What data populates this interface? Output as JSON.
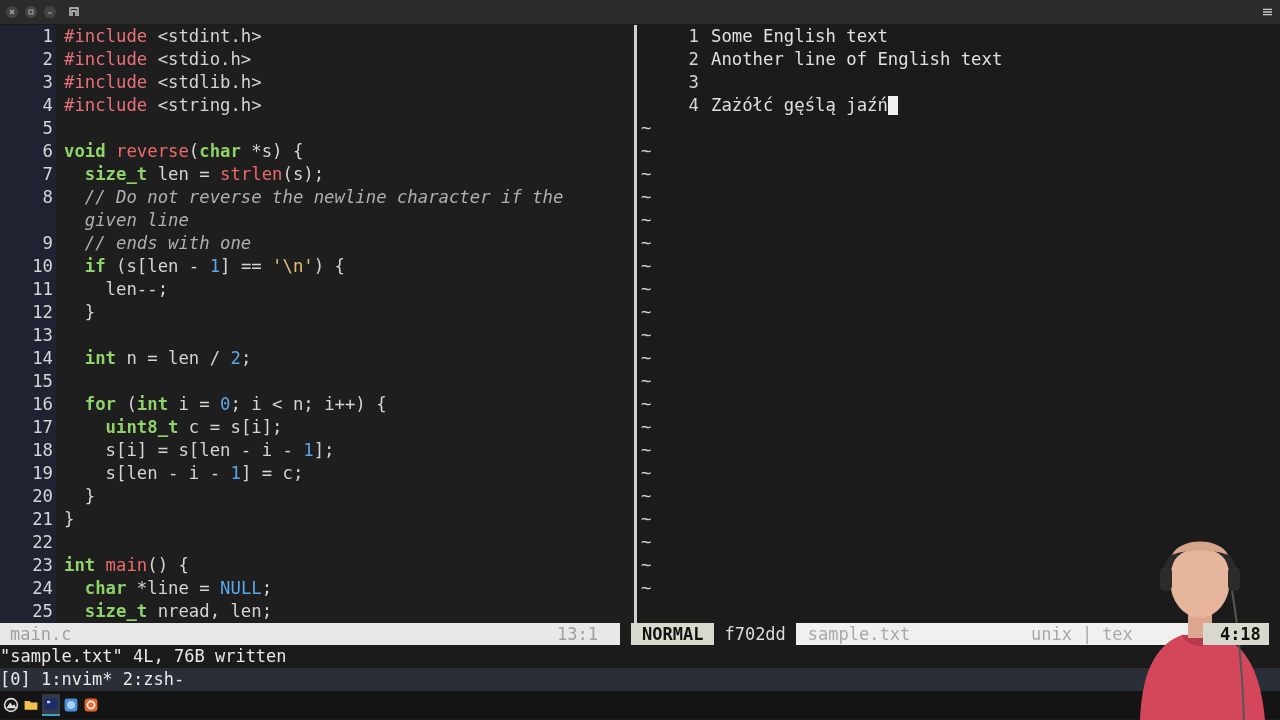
{
  "left_pane": {
    "lines": [
      {
        "num": "1",
        "tokens": [
          {
            "t": "#include",
            "kind": "pre"
          },
          {
            "t": " <stdint.h>",
            "kind": "plain"
          }
        ]
      },
      {
        "num": "2",
        "tokens": [
          {
            "t": "#include",
            "kind": "pre"
          },
          {
            "t": " <stdio.h>",
            "kind": "plain"
          }
        ]
      },
      {
        "num": "3",
        "tokens": [
          {
            "t": "#include",
            "kind": "pre"
          },
          {
            "t": " <stdlib.h>",
            "kind": "plain"
          }
        ]
      },
      {
        "num": "4",
        "tokens": [
          {
            "t": "#include",
            "kind": "pre"
          },
          {
            "t": " <string.h>",
            "kind": "plain"
          }
        ]
      },
      {
        "num": "5"
      },
      {
        "num": "6",
        "tokens": [
          {
            "t": "void",
            "kind": "type"
          },
          {
            "t": " reverse",
            "kind": "fn"
          },
          {
            "t": "(",
            "kind": "plain"
          },
          {
            "t": "char",
            "kind": "type"
          },
          {
            "t": " *s) {",
            "kind": "plain"
          }
        ]
      },
      {
        "num": "7",
        "tokens": [
          {
            "t": "  size_t",
            "kind": "type"
          },
          {
            "t": " len = ",
            "kind": "plain"
          },
          {
            "t": "strlen",
            "kind": "fn"
          },
          {
            "t": "(s);",
            "kind": "plain"
          }
        ]
      },
      {
        "num": "8",
        "tokens": [
          {
            "t": "  // Do not reverse the newline character if the",
            "kind": "com"
          }
        ]
      },
      {
        "tokens": [
          {
            "t": "  given line",
            "kind": "com"
          }
        ]
      },
      {
        "num": "9",
        "tokens": [
          {
            "t": "  // ends with one",
            "kind": "com"
          }
        ]
      },
      {
        "num": "10",
        "tokens": [
          {
            "t": "  if",
            "kind": "kw"
          },
          {
            "t": " (s[len - ",
            "kind": "plain"
          },
          {
            "t": "1",
            "kind": "num"
          },
          {
            "t": "] == ",
            "kind": "plain"
          },
          {
            "t": "'\\n'",
            "kind": "str"
          },
          {
            "t": ") {",
            "kind": "plain"
          }
        ]
      },
      {
        "num": "11",
        "tokens": [
          {
            "t": "    len--;",
            "kind": "plain"
          }
        ]
      },
      {
        "num": "12",
        "tokens": [
          {
            "t": "  }",
            "kind": "plain"
          }
        ]
      },
      {
        "num": "13"
      },
      {
        "num": "14",
        "tokens": [
          {
            "t": "  int",
            "kind": "type"
          },
          {
            "t": " n = len / ",
            "kind": "plain"
          },
          {
            "t": "2",
            "kind": "num"
          },
          {
            "t": ";",
            "kind": "plain"
          }
        ]
      },
      {
        "num": "15"
      },
      {
        "num": "16",
        "tokens": [
          {
            "t": "  for",
            "kind": "kw"
          },
          {
            "t": " (",
            "kind": "plain"
          },
          {
            "t": "int",
            "kind": "type"
          },
          {
            "t": " i = ",
            "kind": "plain"
          },
          {
            "t": "0",
            "kind": "num"
          },
          {
            "t": "; i < n; i++) {",
            "kind": "plain"
          }
        ]
      },
      {
        "num": "17",
        "tokens": [
          {
            "t": "    uint8_t",
            "kind": "type"
          },
          {
            "t": " c = s[i];",
            "kind": "plain"
          }
        ]
      },
      {
        "num": "18",
        "tokens": [
          {
            "t": "    s[i] = s[len - i - ",
            "kind": "plain"
          },
          {
            "t": "1",
            "kind": "num"
          },
          {
            "t": "];",
            "kind": "plain"
          }
        ]
      },
      {
        "num": "19",
        "tokens": [
          {
            "t": "    s[len - i - ",
            "kind": "plain"
          },
          {
            "t": "1",
            "kind": "num"
          },
          {
            "t": "] = c;",
            "kind": "plain"
          }
        ]
      },
      {
        "num": "20",
        "tokens": [
          {
            "t": "  }",
            "kind": "plain"
          }
        ]
      },
      {
        "num": "21",
        "tokens": [
          {
            "t": "}",
            "kind": "plain"
          }
        ]
      },
      {
        "num": "22"
      },
      {
        "num": "23",
        "tokens": [
          {
            "t": "int",
            "kind": "type"
          },
          {
            "t": " main",
            "kind": "fn"
          },
          {
            "t": "() {",
            "kind": "plain"
          }
        ]
      },
      {
        "num": "24",
        "tokens": [
          {
            "t": "  char",
            "kind": "type"
          },
          {
            "t": " *line = ",
            "kind": "plain"
          },
          {
            "t": "NULL",
            "kind": "const"
          },
          {
            "t": ";",
            "kind": "plain"
          }
        ]
      },
      {
        "num": "25",
        "tokens": [
          {
            "t": "  size_t",
            "kind": "type"
          },
          {
            "t": " nread, len;",
            "kind": "plain"
          }
        ]
      }
    ]
  },
  "right_pane": {
    "lines": [
      {
        "num": "1",
        "text": "Some English text",
        "cursor": false
      },
      {
        "num": "2",
        "text": "Another line of English text",
        "cursor": false
      },
      {
        "num": "3",
        "cursor": false
      },
      {
        "num": "4",
        "text": "Zażółć gęślą jaźń",
        "cursor": true
      }
    ],
    "empty_markers": [
      "~",
      "~",
      "~",
      "~",
      "~",
      "~",
      "~",
      "~",
      "~",
      "~",
      "~",
      "~",
      "~",
      "~",
      "~",
      "~",
      "~",
      "~",
      "~",
      "~",
      "~"
    ]
  },
  "status_left": {
    "file": "main.c",
    "position": "13:1"
  },
  "status_right": {
    "mode": "NORMAL",
    "branch": "f702dd",
    "file": "sample.txt",
    "format": "unix",
    "separator": "|",
    "filetype": "tex",
    "position": "4:18"
  },
  "message": "\"sample.txt\" 4L, 76B written",
  "tmux_bar": "[0] 1:nvim* 2:zsh-",
  "taskbar": [
    {
      "kind": "launcher",
      "selected": false
    },
    {
      "kind": "folder",
      "selected": false
    },
    {
      "kind": "terminal",
      "selected": true
    },
    {
      "kind": "browser",
      "selected": false
    },
    {
      "kind": "app",
      "selected": false
    }
  ]
}
